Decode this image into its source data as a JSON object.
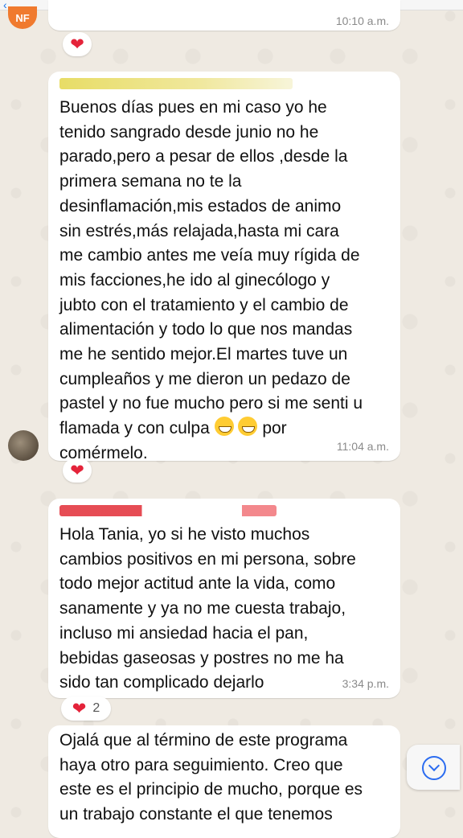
{
  "header": {
    "contact_name": ""
  },
  "messages": [
    {
      "avatar_initials": "NF",
      "time": "10:10 a.m.",
      "reaction": {
        "emoji": "❤",
        "count": ""
      }
    },
    {
      "sender": "",
      "lines": [
        "Buenos días pues en mi caso yo he",
        "tenido sangrado desde junio no he",
        "parado,pero a pesar de ellos ,desde la",
        "primera semana no te la",
        "desinflamación,mis estados de animo",
        "sin estrés,más relajada,hasta mi cara",
        "me cambio antes me veía muy rígida de",
        "mis facciones,he ido al ginecólogo y",
        "jubto con el tratamiento y el cambio de",
        "alimentación y todo lo que nos mandas",
        "me he sentido mejor.El martes tuve un",
        "cumpleaños y me dieron un pedazo de",
        "pastel y no fue mucho pero si me senti u",
        "flamada y con culpa",
        "comérmelo."
      ],
      "last_line_suffix": "por",
      "emoji_name": "grinning-face-icon",
      "time": "11:04 a.m.",
      "reaction": {
        "emoji": "❤",
        "count": ""
      }
    },
    {
      "sender": "",
      "lines": [
        "Hola Tania, yo si he visto muchos",
        "cambios positivos en mi persona, sobre",
        "todo mejor actitud ante la vida, como",
        "sanamente y ya no me cuesta trabajo,",
        "incluso mi ansiedad hacia el pan,",
        "bebidas gaseosas y postres no me ha",
        "sido tan complicado dejarlo"
      ],
      "time": "3:34 p.m.",
      "reaction": {
        "emoji": "❤",
        "count": "2"
      }
    },
    {
      "lines": [
        "Ojalá que al término de este programa",
        "haya otro para seguimiento. Creo que",
        "este es el principio de mucho, porque es",
        "un trabajo constante el que tenemos"
      ]
    }
  ],
  "colors": {
    "accent": "#2b6cf0",
    "heart": "#e4233a",
    "background": "#efeae2",
    "sender1": "#c9b700",
    "sender2": "#e0202a"
  }
}
